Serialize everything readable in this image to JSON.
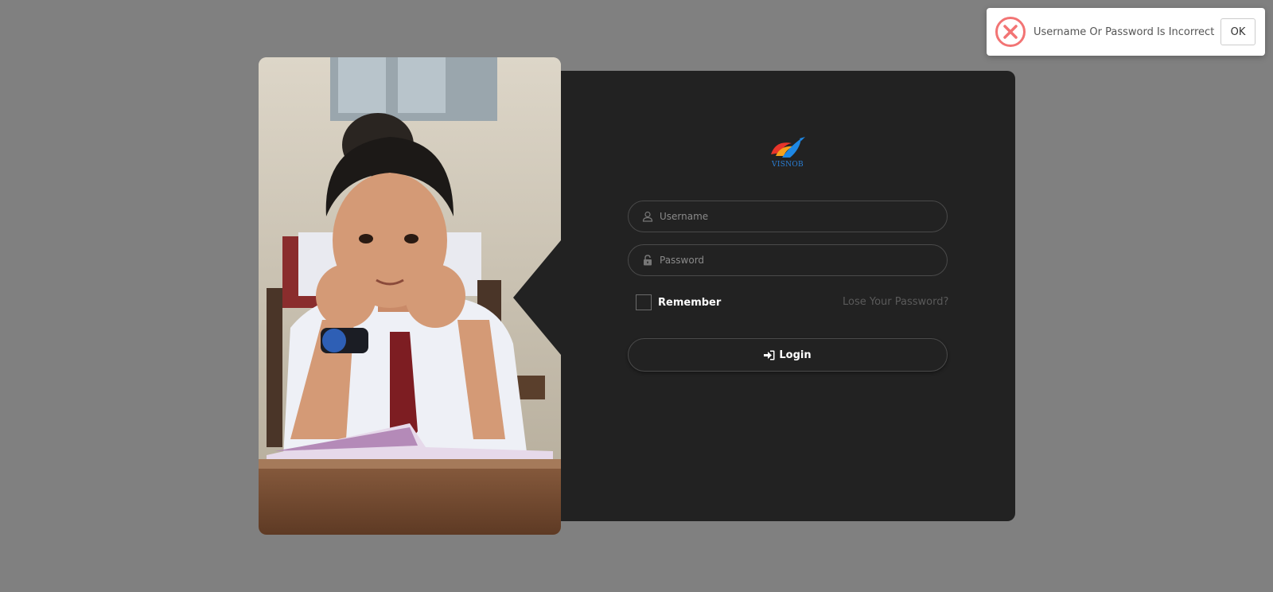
{
  "hero_image": {
    "alt": ""
  },
  "brand": {
    "logo_text": "VISNOB"
  },
  "form": {
    "username": {
      "placeholder": "Username",
      "value": "",
      "icon": "user-icon"
    },
    "password": {
      "placeholder": "Password",
      "value": "",
      "icon": "lock-icon"
    },
    "remember_label": "Remember",
    "lose_password_link": "Lose Your Password?",
    "login_label": "Login",
    "login_icon": "sign-in-icon"
  },
  "toast": {
    "message": "Username Or Password Is Incorrect",
    "ok_label": "OK",
    "icon": "error-x-icon",
    "color": "#f27474"
  },
  "colors": {
    "background": "#808080",
    "card": "#222222",
    "logo_text": "#2a7fd6"
  }
}
